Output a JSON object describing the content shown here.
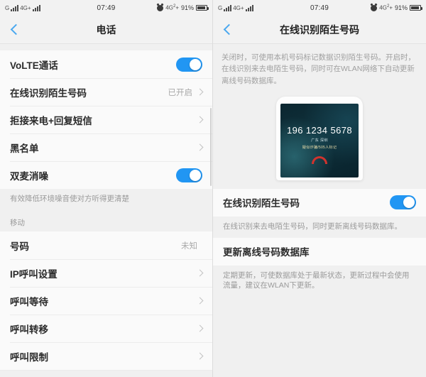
{
  "status_bar": {
    "carrier_glyph": "G",
    "network": "4G+",
    "time": "07:49",
    "alarm_icon": "alarm-clock-icon",
    "network_right": "4G",
    "network_right_sub": "2",
    "network_right_plus": "+",
    "battery_percent": "91%"
  },
  "left_screen": {
    "title": "电话",
    "back_icon": "chevron-left-icon",
    "rows_group1": [
      {
        "label": "VoLTE通话",
        "control": "toggle",
        "toggle_on": true
      },
      {
        "label": "在线识别陌生号码",
        "value": "已开启",
        "control": "chevron"
      },
      {
        "label": "拒接来电+回复短信",
        "value": "",
        "control": "chevron"
      },
      {
        "label": "黑名单",
        "value": "",
        "control": "chevron"
      },
      {
        "label": "双麦消噪",
        "control": "toggle",
        "toggle_on": true
      }
    ],
    "hint1": "有效降低环境噪音使对方听得更清楚",
    "section_mobile": "移动",
    "rows_group2": [
      {
        "label": "号码",
        "value": "未知",
        "control": "none"
      },
      {
        "label": "IP呼叫设置",
        "value": "",
        "control": "chevron"
      },
      {
        "label": "呼叫等待",
        "value": "",
        "control": "chevron"
      },
      {
        "label": "呼叫转移",
        "value": "",
        "control": "chevron"
      },
      {
        "label": "呼叫限制",
        "value": "",
        "control": "chevron"
      }
    ]
  },
  "right_screen": {
    "title": "在线识别陌生号码",
    "back_icon": "chevron-left-icon",
    "description": "关闭时，可使用本机号码标记数据识别陌生号码。开启时，在线识别来去电陌生号码，同时可在WLAN网络下自动更新离线号码数据库。",
    "phone_mock": {
      "number": "196 1234 5678",
      "location": "广东 深圳",
      "tag": "疑似诈骗/505人标记",
      "hangup_icon": "hangup-phone-icon",
      "hangup_color": "#d1332e"
    },
    "setting_row": {
      "label": "在线识别陌生号码",
      "toggle_on": true
    },
    "setting_hint": "在线识别来去电陌生号码，同时更新离线号码数据库。",
    "update_row": {
      "label": "更新离线号码数据库"
    },
    "update_hint": "定期更新，可使数据库处于最新状态，更新过程中会使用流量，建议在WLAN下更新。"
  },
  "colors": {
    "accent": "#2196f3",
    "back_arrow": "#4aa8ef",
    "bg": "#f0f0f0",
    "row_bg": "#fafafa"
  }
}
